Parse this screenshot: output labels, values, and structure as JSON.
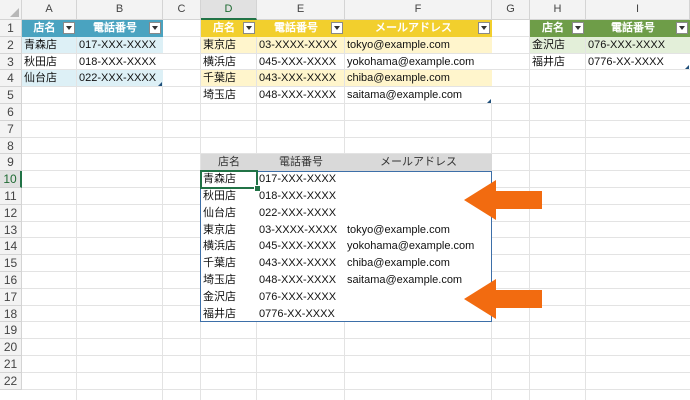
{
  "columns": [
    "A",
    "B",
    "C",
    "D",
    "E",
    "F",
    "G",
    "H",
    "I"
  ],
  "rows": [
    "1",
    "2",
    "3",
    "4",
    "5",
    "6",
    "7",
    "8",
    "9",
    "10",
    "11",
    "12",
    "13",
    "14",
    "15",
    "16",
    "17",
    "18",
    "19",
    "20",
    "21",
    "22"
  ],
  "colors": {
    "blue_header": "#4aa3c0",
    "blue_band": "#ddf0f6",
    "yellow_header": "#f2cf2d",
    "yellow_band": "#fff5cc",
    "green_header": "#6e9d48",
    "green_band": "#e3efd9",
    "gray_header": "#d9d9d9",
    "arrow": "#f26b10",
    "selection": "#217346"
  },
  "table_blue": {
    "headers": [
      "店名",
      "電話番号"
    ],
    "rows": [
      [
        "青森店",
        "017-XXX-XXXX"
      ],
      [
        "秋田店",
        "018-XXX-XXXX"
      ],
      [
        "仙台店",
        "022-XXX-XXXX"
      ]
    ]
  },
  "table_yellow": {
    "headers": [
      "店名",
      "電話番号",
      "メールアドレス"
    ],
    "rows": [
      [
        "東京店",
        "03-XXXX-XXXX",
        "tokyo@example.com"
      ],
      [
        "横浜店",
        "045-XXX-XXXX",
        "yokohama@example.com"
      ],
      [
        "千葉店",
        "043-XXX-XXXX",
        "chiba@example.com"
      ],
      [
        "埼玉店",
        "048-XXX-XXXX",
        "saitama@example.com"
      ]
    ]
  },
  "table_green": {
    "headers": [
      "店名",
      "電話番号"
    ],
    "rows": [
      [
        "金沢店",
        "076-XXX-XXXX"
      ],
      [
        "福井店",
        "0776-XX-XXXX"
      ]
    ]
  },
  "result_table": {
    "headers": [
      "店名",
      "電話番号",
      "メールアドレス"
    ],
    "rows": [
      [
        "青森店",
        "017-XXX-XXXX",
        ""
      ],
      [
        "秋田店",
        "018-XXX-XXXX",
        ""
      ],
      [
        "仙台店",
        "022-XXX-XXXX",
        ""
      ],
      [
        "東京店",
        "03-XXXX-XXXX",
        "tokyo@example.com"
      ],
      [
        "横浜店",
        "045-XXX-XXXX",
        "yokohama@example.com"
      ],
      [
        "千葉店",
        "043-XXX-XXXX",
        "chiba@example.com"
      ],
      [
        "埼玉店",
        "048-XXX-XXXX",
        "saitama@example.com"
      ],
      [
        "金沢店",
        "076-XXX-XXXX",
        ""
      ],
      [
        "福井店",
        "0776-XX-XXXX",
        ""
      ]
    ]
  },
  "selection": {
    "active_cell": "D10",
    "active_column": "D",
    "active_row": "10"
  }
}
